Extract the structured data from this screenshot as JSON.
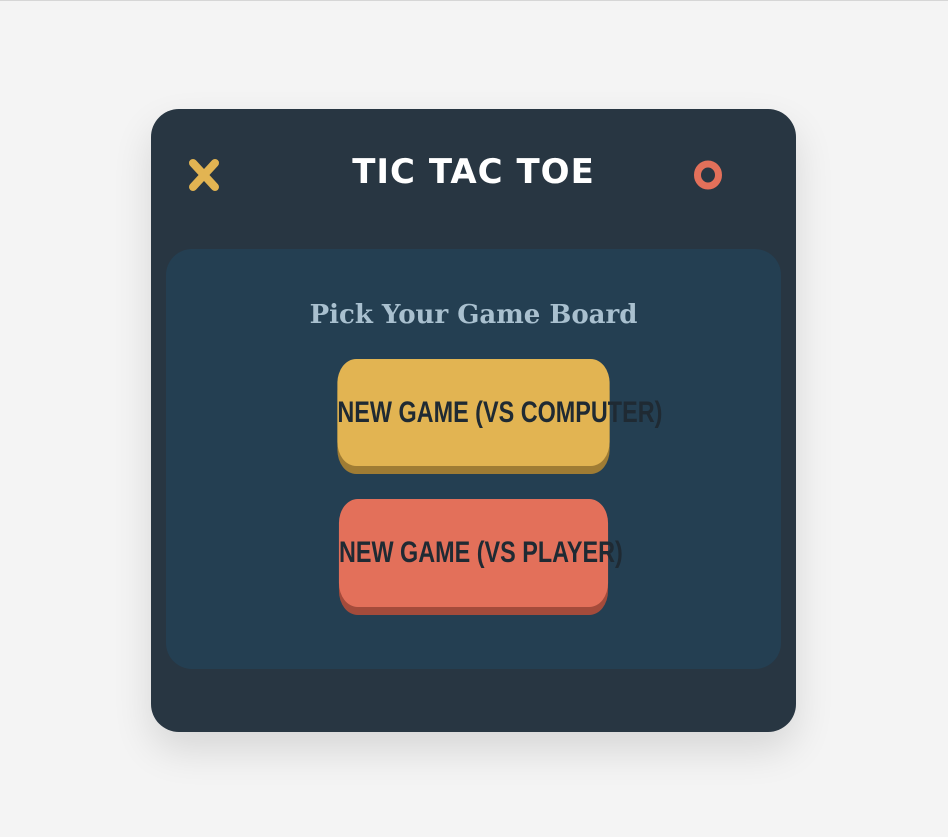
{
  "header": {
    "title": "TIC TAC TOE",
    "x_icon": "x-mark-icon",
    "o_icon": "o-mark-icon"
  },
  "board": {
    "subtitle": "Pick Your Game Board",
    "buttons": [
      {
        "label": "NEW GAME (VS COMPUTER)",
        "color": "#e2b452"
      },
      {
        "label": "NEW GAME (VS PLAYER)",
        "color": "#e3705a"
      }
    ]
  },
  "colors": {
    "page_background": "#f4f4f4",
    "card_background": "#283642",
    "panel_background": "#243f52",
    "x_color": "#e2b452",
    "o_color": "#e3705a",
    "title_color": "#ffffff",
    "subtitle_color": "#a9c0cf"
  }
}
